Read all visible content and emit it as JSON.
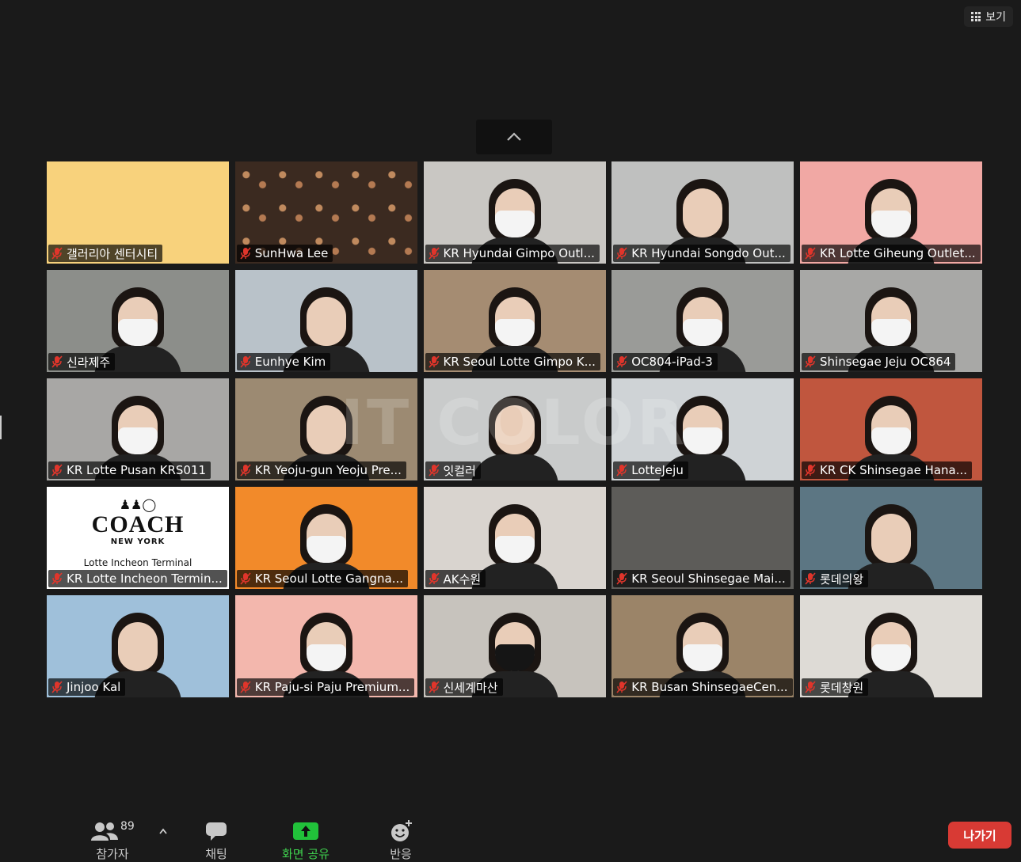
{
  "top": {
    "view_label": "보기"
  },
  "participants": [
    {
      "name": "갤러리아 센터시티",
      "bg": "#f8d27c",
      "person": false
    },
    {
      "name": "SunHwa Lee",
      "bg": "#3b2a20",
      "person": false,
      "pattern": "dots"
    },
    {
      "name": "KR Hyundai Gimpo Outl...",
      "bg": "#c9c7c3",
      "person": true,
      "mask": "white"
    },
    {
      "name": "KR Hyundai Songdo Out...",
      "bg": "#bfc0bf",
      "person": true,
      "mask": "none"
    },
    {
      "name": "KR Lotte Giheung Outlet...",
      "bg": "#f1a8a4",
      "person": true,
      "mask": "white"
    },
    {
      "name": "신라제주",
      "bg": "#8c8e8a",
      "person": true,
      "mask": "white"
    },
    {
      "name": "Eunhye Kim",
      "bg": "#b9c2c9",
      "person": true,
      "mask": "none"
    },
    {
      "name": "KR Seoul Lotte Gimpo K...",
      "bg": "#a58c72",
      "person": true,
      "mask": "white"
    },
    {
      "name": "OC804-iPad-3",
      "bg": "#9a9b98",
      "person": true,
      "mask": "white"
    },
    {
      "name": "Shinsegae Jeju OC864",
      "bg": "#a8a8a6",
      "person": true,
      "mask": "white"
    },
    {
      "name": "KR Lotte Pusan KRS011",
      "bg": "#a8a7a5",
      "person": true,
      "mask": "white"
    },
    {
      "name": "KR Yeoju-gun Yeoju Pre...",
      "bg": "#9c8a72",
      "person": true,
      "mask": "none"
    },
    {
      "name": "잇컬러",
      "bg": "#c9cbcb",
      "person": true,
      "mask": "none",
      "speaker": true
    },
    {
      "name": "LotteJeju",
      "bg": "#cfd3d6",
      "person": true,
      "mask": "white"
    },
    {
      "name": "KR CK Shinsegae Hana...",
      "bg": "#c0563e",
      "person": true,
      "mask": "white"
    },
    {
      "name": "KR Lotte Incheon Termin...",
      "bg": "#ffffff",
      "person": false,
      "logo": true
    },
    {
      "name": "KR Seoul Lotte Gangna...",
      "bg": "#f28a2a",
      "person": true,
      "mask": "white"
    },
    {
      "name": "AK수원",
      "bg": "#d9d4cf",
      "person": true,
      "mask": "white"
    },
    {
      "name": "KR Seoul Shinsegae Mai...",
      "bg": "#5d5c59",
      "person": false
    },
    {
      "name": "롯데의왕",
      "bg": "#5c7683",
      "person": true,
      "mask": "none"
    },
    {
      "name": "Jinjoo Kal",
      "bg": "#9fc0da",
      "person": true,
      "mask": "none"
    },
    {
      "name": "KR Paju-si Paju Premium...",
      "bg": "#f3b7ad",
      "person": true,
      "mask": "white"
    },
    {
      "name": "신세계마산",
      "bg": "#c7c3bd",
      "person": true,
      "mask": "dark"
    },
    {
      "name": "KR Busan ShinsegaeCen...",
      "bg": "#9b8468",
      "person": true,
      "mask": "white"
    },
    {
      "name": "롯데창원",
      "bg": "#dedbd6",
      "person": true,
      "mask": "white"
    }
  ],
  "logo": {
    "brand": "COACH",
    "sub": "NEW YORK",
    "caption": "Lotte Incheon Terminal"
  },
  "watermark": "IT COLOR",
  "toolbar": {
    "participants_label": "참가자",
    "participants_count": "89",
    "chat_label": "채팅",
    "share_label": "화면 공유",
    "reactions_label": "반응",
    "leave_label": "나가기"
  }
}
